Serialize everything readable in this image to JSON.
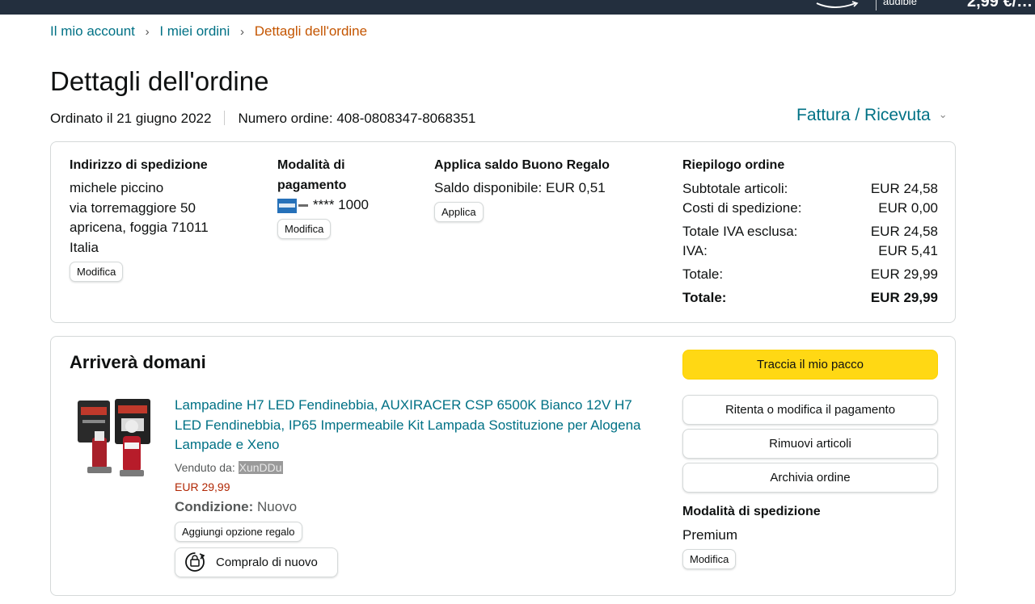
{
  "topbar": {
    "audible_label": "audible",
    "price_label": "2,99 €/…",
    "logo_icon": "prime-video-logo-icon"
  },
  "breadcrumb": {
    "account": "Il mio account",
    "orders": "I miei ordini",
    "current": "Dettagli dell'ordine",
    "separator": "›"
  },
  "page": {
    "title": "Dettagli dell'ordine",
    "ordered_on": "Ordinato il 21 giugno 2022",
    "order_number": "Numero ordine: 408-0808347-8068351",
    "invoice_label": "Fattura / Ricevuta"
  },
  "shipping_address": {
    "heading": "Indirizzo di spedizione",
    "name": "michele piccino",
    "street": "via torremaggiore 50",
    "city": "apricena, foggia 71011",
    "country": "Italia",
    "edit_label": "Modifica"
  },
  "payment": {
    "heading_line1": "Modalità di",
    "heading_line2": "pagamento",
    "card_digits": "**** 1000",
    "card_icon": "amex-card-icon",
    "edit_label": "Modifica"
  },
  "gift_card": {
    "heading": "Applica saldo Buono Regalo",
    "balance": "Saldo disponibile: EUR 0,51",
    "apply_label": "Applica"
  },
  "summary": {
    "heading": "Riepilogo ordine",
    "rows": [
      {
        "label": "Subtotale articoli:",
        "value": "EUR 24,58"
      },
      {
        "label": "Costi di spedizione:",
        "value": "EUR 0,00"
      },
      {
        "label": "Totale IVA esclusa:",
        "value": "EUR 24,58"
      },
      {
        "label": "IVA:",
        "value": "EUR 5,41"
      },
      {
        "label": "Totale:",
        "value": "EUR 29,99"
      },
      {
        "label": "Totale:",
        "value": "EUR 29,99"
      }
    ]
  },
  "shipment": {
    "heading": "Arriverà domani",
    "product_title": "Lampadine H7 LED Fendinebbia, AUXIRACER CSP 6500K Bianco 12V H7 LED Fendinebbia, IP65 Impermeabile Kit Lampada Sostituzione per Alogena Lampade e Xeno",
    "seller_label": "Venduto da:",
    "seller_name": "XunDDu",
    "price": "EUR 29,99",
    "condition_label": "Condizione:",
    "condition_value": "Nuovo",
    "gift_label": "Aggiungi opzione regalo",
    "rebuy_label": "Compralo di nuovo",
    "rebuy_icon": "buy-again-icon"
  },
  "actions": {
    "track": "Traccia il mio pacco",
    "retry_payment": "Ritenta o modifica il pagamento",
    "remove_items": "Rimuovi articoli",
    "archive": "Archivia ordine",
    "shipping_method_heading": "Modalità di spedizione",
    "shipping_method_value": "Premium",
    "edit_label": "Modifica"
  },
  "colors": {
    "link": "#007185",
    "breadcrumb_current": "#c45500",
    "price": "#b12704",
    "track_button": "#ffd814",
    "topbar": "#232f3e"
  }
}
